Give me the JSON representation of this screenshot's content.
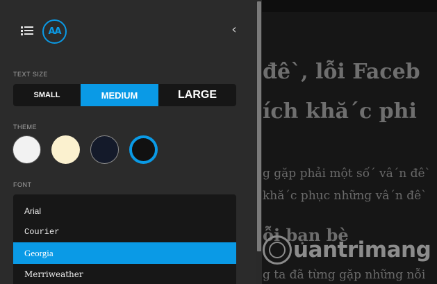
{
  "panel": {
    "collapse_glyph": "‹",
    "logo_text": "AA",
    "text_size_label": "TEXT SIZE",
    "size_options": [
      {
        "label": "SMALL",
        "selected": false
      },
      {
        "label": "MEDIUM",
        "selected": true
      },
      {
        "label": "LARGE",
        "selected": false
      }
    ],
    "theme_label": "THEME",
    "themes": [
      {
        "name": "white",
        "color": "#f2f2f2",
        "selected": false
      },
      {
        "name": "cream",
        "color": "#fbf1cf",
        "selected": false
      },
      {
        "name": "navy",
        "color": "#141a2a",
        "selected": false
      },
      {
        "name": "black",
        "color": "#111111",
        "selected": true
      }
    ],
    "font_label": "FONT",
    "fonts": [
      {
        "label": "Arial",
        "selected": false
      },
      {
        "label": "Courier",
        "selected": false
      },
      {
        "label": "Georgia",
        "selected": true
      },
      {
        "label": "Merriweather",
        "selected": false
      }
    ],
    "accent_color": "#0a9ae6",
    "icons": {
      "menu": "list-icon",
      "logo": "aa-logo-icon",
      "collapse": "chevron-left-icon"
    }
  },
  "reader": {
    "heading_line1": "đê`, lỗi Faceb",
    "heading_line2": "ích khă´c phi",
    "para_line1": "g gặp phải một số´ vâ´n đê`",
    "para_line2": "khă´c phục những vâ´n đê`",
    "subheading": "ỗi bạn bè",
    "last_line": "g ta đã từng gặp những nỗi",
    "watermark": "uantrimang"
  }
}
